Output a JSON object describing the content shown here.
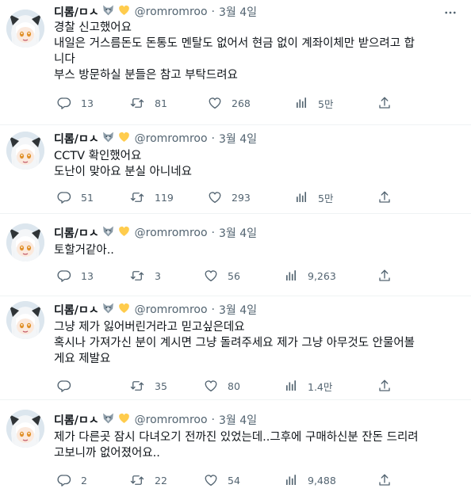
{
  "author": {
    "name": "디롬/ㅁㅅ",
    "handle": "@romromroo",
    "separator": "·",
    "date": "3월 4일"
  },
  "tweets": [
    {
      "lines": [
        "경찰 신고했어요",
        "내일은 거스름돈도 돈통도 멘탈도 없어서 현금 없이 계좌이체만 받으려고 합",
        "니다",
        "부스 방문하실 분들은 참고 부탁드려요"
      ],
      "replies": "13",
      "retweets": "81",
      "likes": "268",
      "views": "5만"
    },
    {
      "lines": [
        "CCTV 확인했어요",
        "도난이 맞아요 분실 아니네요"
      ],
      "replies": "51",
      "retweets": "119",
      "likes": "293",
      "views": "5만"
    },
    {
      "lines": [
        "토할거같아.."
      ],
      "replies": "13",
      "retweets": "3",
      "likes": "56",
      "views": "9,263"
    },
    {
      "lines": [
        "그냥 제가 잃어버린거라고 믿고싶은데요",
        "혹시나 가져가신 분이 계시면 그냥 돌려주세요 제가 그냥 아무것도 안물어볼",
        "게요 제발요"
      ],
      "replies": "",
      "retweets": "35",
      "likes": "80",
      "views": "1.4만"
    },
    {
      "lines": [
        "제가 다른곳 잠시 다녀오기 전까진 있었는데..그후에 구매하신분 잔돈 드리려",
        "고보니까 없어졌어요.."
      ],
      "replies": "2",
      "retweets": "22",
      "likes": "54",
      "views": "9,488"
    }
  ],
  "icons": {
    "reply": "reply-icon",
    "retweet": "retweet-icon",
    "like": "heart-icon",
    "views": "views-icon",
    "share": "share-icon",
    "more": "more-icon",
    "wolf": "wolf-emoji-icon",
    "heart_emoji": "yellow-heart-emoji-icon"
  },
  "colors": {
    "text": "#0f1419",
    "secondary": "#536471",
    "divider": "#eff3f4",
    "yellow_heart": "#ffcc4d"
  }
}
